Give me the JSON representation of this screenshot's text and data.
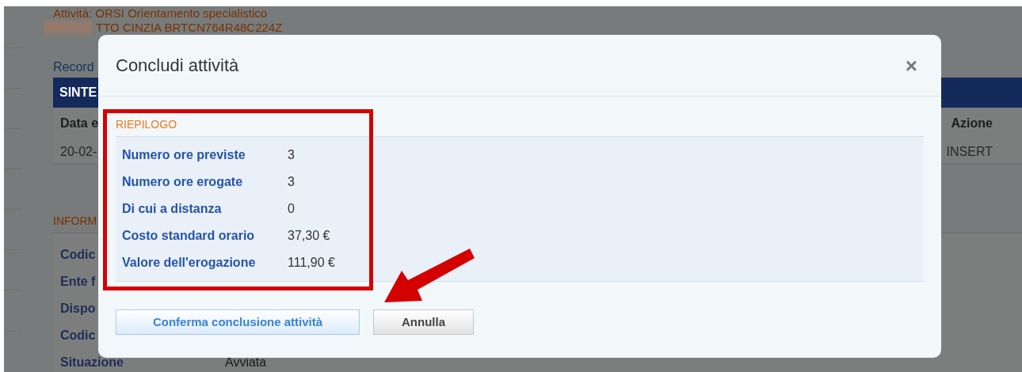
{
  "background_page": {
    "activity_title": "Attività: ORSI Orientamento specialistico",
    "person": "TTO CINZIA BRTCN764R48C224Z",
    "record_link": "Record",
    "summary_table": {
      "title": "SINTE",
      "columns": [
        "Data e",
        "Azione"
      ],
      "rows": [
        [
          "20-02-",
          "INSERT"
        ]
      ]
    },
    "info_section": {
      "title": "INFORM",
      "rows": [
        {
          "label": "Codic"
        },
        {
          "label": "Ente f"
        },
        {
          "label": "Dispo"
        },
        {
          "label": "Codic"
        },
        {
          "label": "Situazione",
          "value": "Avviata"
        }
      ]
    }
  },
  "dialog": {
    "title": "Concludi attività",
    "close": "×",
    "section_title": "RIEPILOGO",
    "rows": [
      {
        "label": "Numero ore previste",
        "value": "3"
      },
      {
        "label": "Numero ore erogate",
        "value": "3"
      },
      {
        "label": "Di cui a distanza",
        "value": "0"
      },
      {
        "label": "Costo standard orario",
        "value": "37,30 €"
      },
      {
        "label": "Valore dell'erogazione",
        "value": "111,90 €"
      }
    ],
    "buttons": [
      {
        "label": "Conferma conclusione attività",
        "kind": "primary"
      },
      {
        "label": "Annulla",
        "kind": "secondary"
      }
    ]
  }
}
